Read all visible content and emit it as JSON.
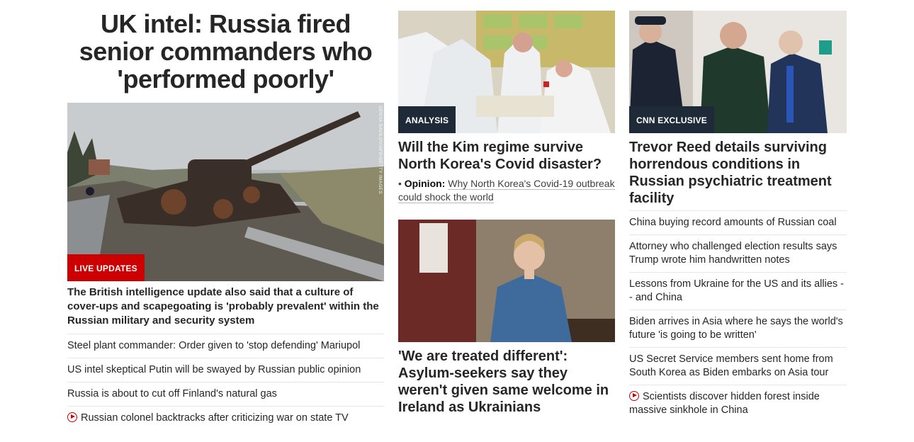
{
  "lead": {
    "headline_lines": [
      "UK intel: Russia fired",
      "senior commanders who",
      "'performed poorly'"
    ],
    "image_credit": "GENYA SAVILOV/AFP/GETTY IMAGES",
    "badge": "LIVE UPDATES",
    "summary": "The British intelligence update also said that a culture of cover-ups and scapegoating is 'probably prevalent' within the Russian military and security system",
    "links": [
      {
        "text": "Steel plant commander: Order given to 'stop defending' Mariupol"
      },
      {
        "text": "US intel skeptical Putin will be swayed by Russian public opinion"
      },
      {
        "text": "Russia is about to cut off Finland's natural gas"
      },
      {
        "text": "Russian colonel backtracks after criticizing war on state TV",
        "icon": "play-video-icon"
      }
    ]
  },
  "middle": {
    "story1": {
      "badge": "ANALYSIS",
      "title": "Will the Kim regime survive North Korea's Covid disaster?",
      "opinion_label": "Opinion:",
      "opinion_text": "Why North Korea's Covid-19 outbreak could shock the world"
    },
    "story2": {
      "title": "'We are treated different': Asylum-seekers say they weren't given same welcome in Ireland as Ukrainians"
    }
  },
  "right": {
    "badge": "CNN EXCLUSIVE",
    "title": "Trevor Reed details surviving horrendous conditions in Russian psychiatric treatment facility",
    "links": [
      {
        "text": "China buying record amounts of Russian coal"
      },
      {
        "text": "Attorney who challenged election results says Trump wrote him handwritten notes"
      },
      {
        "text": "Lessons from Ukraine for the US and its allies -- and China"
      },
      {
        "text": "Biden arrives in Asia where he says the world's future 'is going to be written'"
      },
      {
        "text": "US Secret Service members sent home from South Korea as Biden embarks on Asia tour"
      },
      {
        "text": "Scientists discover hidden forest inside massive sinkhole in China",
        "icon": "play-video-icon"
      }
    ]
  },
  "colors": {
    "live_red": "#cc0000",
    "badge_dark": "#1f2a38"
  }
}
